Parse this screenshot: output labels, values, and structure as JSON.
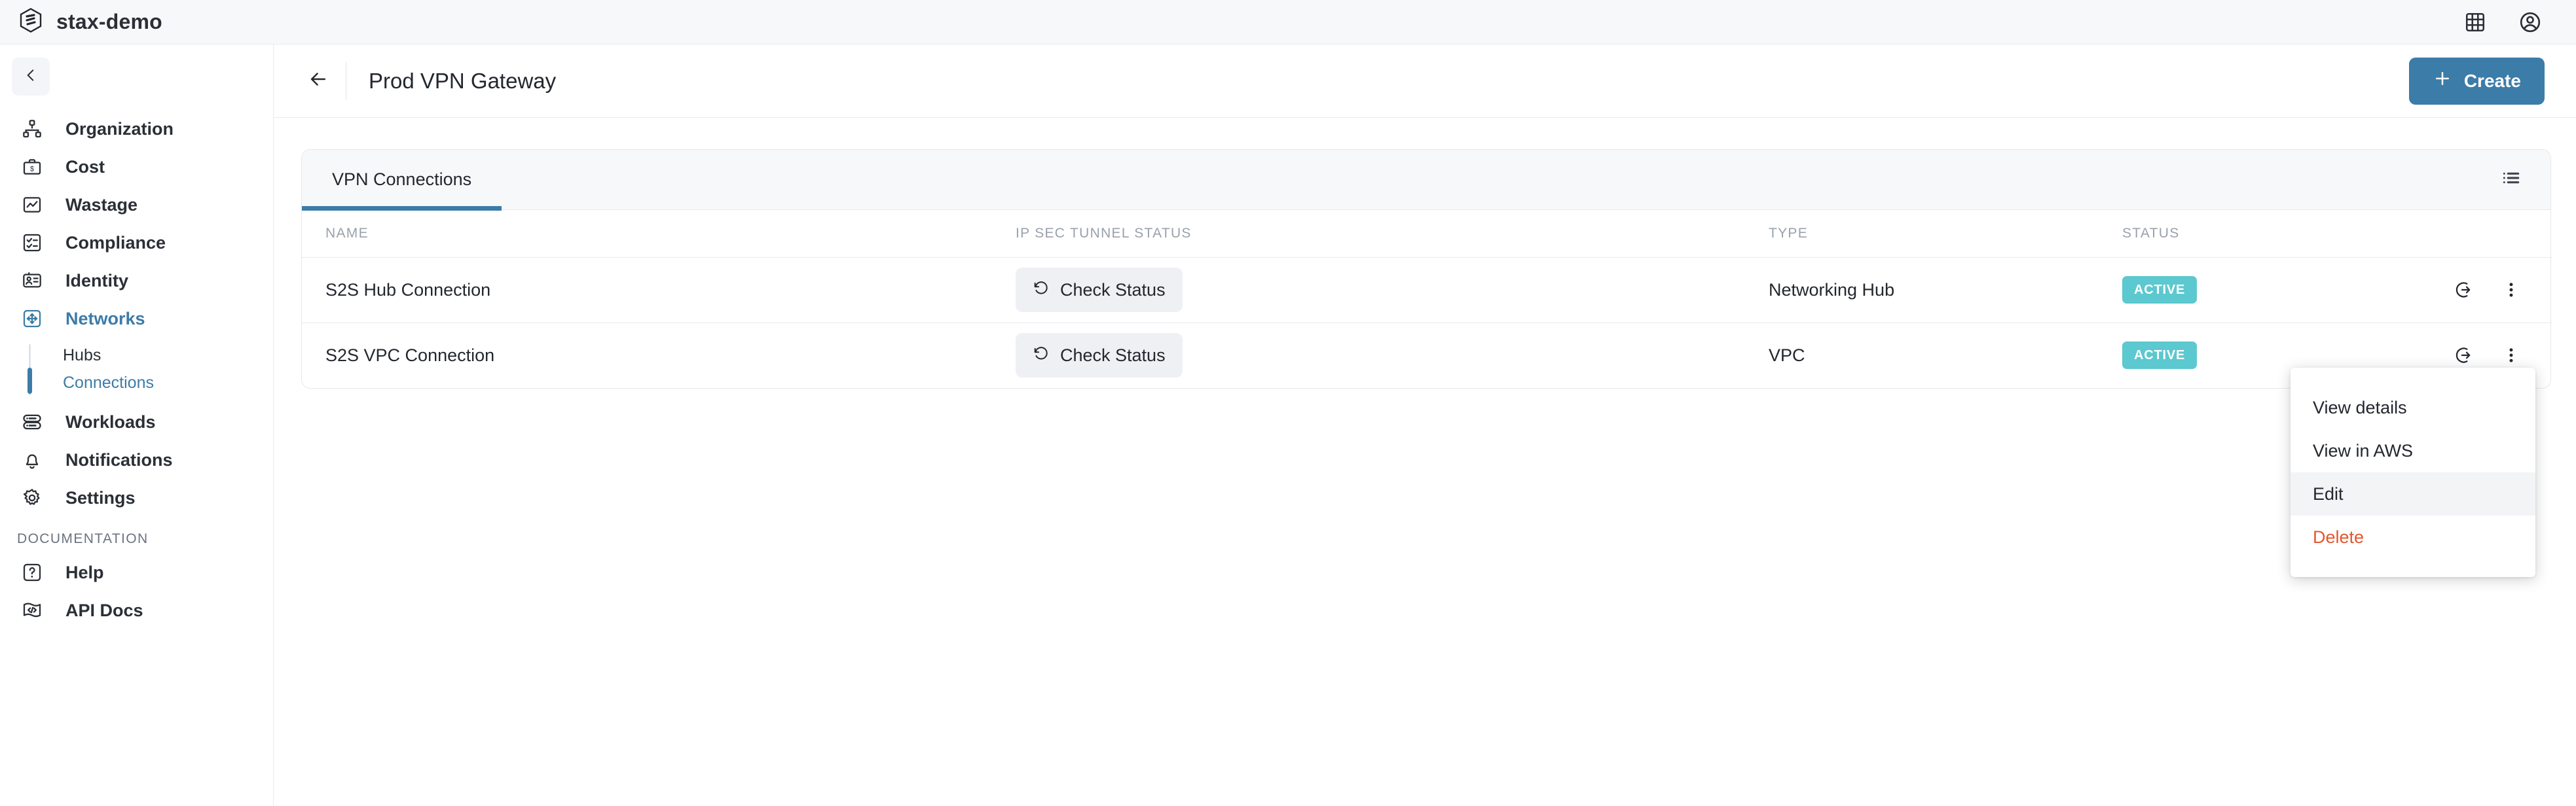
{
  "topbar": {
    "brand": "stax-demo",
    "logo_icon": "stax-hex-logo-icon",
    "icons": [
      {
        "name": "apps-grid-icon",
        "label": "Apps"
      },
      {
        "name": "account-circle-icon",
        "label": "Account"
      }
    ]
  },
  "sidebar": {
    "collapse_icon": "chevron-left-icon",
    "items": [
      {
        "label": "Organization",
        "icon": "org-chart-icon",
        "active": false
      },
      {
        "label": "Cost",
        "icon": "briefcase-dollar-icon",
        "active": false
      },
      {
        "label": "Wastage",
        "icon": "chart-square-icon",
        "active": false
      },
      {
        "label": "Compliance",
        "icon": "checklist-icon",
        "active": false
      },
      {
        "label": "Identity",
        "icon": "id-card-icon",
        "active": false
      },
      {
        "label": "Networks",
        "icon": "move-arrows-square-icon",
        "active": true
      }
    ],
    "sub_items": [
      {
        "label": "Hubs",
        "active": false
      },
      {
        "label": "Connections",
        "active": true
      }
    ],
    "items_after": [
      {
        "label": "Workloads",
        "icon": "server-stack-icon",
        "active": false
      },
      {
        "label": "Notifications",
        "icon": "bell-icon",
        "active": false
      },
      {
        "label": "Settings",
        "icon": "gear-icon",
        "active": false
      }
    ],
    "section_label": "DOCUMENTATION",
    "doc_items": [
      {
        "label": "Help",
        "icon": "question-square-icon",
        "active": false
      },
      {
        "label": "API Docs",
        "icon": "code-flag-icon",
        "active": false
      }
    ]
  },
  "header": {
    "back_icon": "arrow-left-icon",
    "title": "Prod VPN Gateway",
    "create_label": "Create",
    "create_icon": "plus-icon"
  },
  "main": {
    "tabs": [
      {
        "label": "VPN Connections",
        "active": true
      }
    ],
    "list_view_icon": "list-view-icon",
    "table": {
      "columns": [
        "NAME",
        "IP SEC TUNNEL STATUS",
        "TYPE",
        "STATUS"
      ],
      "rows": [
        {
          "name": "S2S Hub Connection",
          "tunnel_action": "Check Status",
          "tunnel_icon": "refresh-ccw-icon",
          "type": "Networking Hub",
          "status": "ACTIVE",
          "open_icon": "arrow-into-circle-icon",
          "menu_icon": "more-vertical-icon"
        },
        {
          "name": "S2S VPC Connection",
          "tunnel_action": "Check Status",
          "tunnel_icon": "refresh-ccw-icon",
          "type": "VPC",
          "status": "ACTIVE",
          "open_icon": "arrow-into-circle-icon",
          "menu_icon": "more-vertical-icon"
        }
      ]
    }
  },
  "dropdown": {
    "items": [
      {
        "label": "View details",
        "state": "normal"
      },
      {
        "label": "View in AWS",
        "state": "normal"
      },
      {
        "label": "Edit",
        "state": "hover"
      },
      {
        "label": "Delete",
        "state": "danger"
      }
    ]
  },
  "colors": {
    "accent": "#3c7ca8",
    "badge_active": "#5cc8cf",
    "danger": "#e4572e",
    "topbar_bg": "#f7f8fa",
    "border": "#e8eaee"
  }
}
